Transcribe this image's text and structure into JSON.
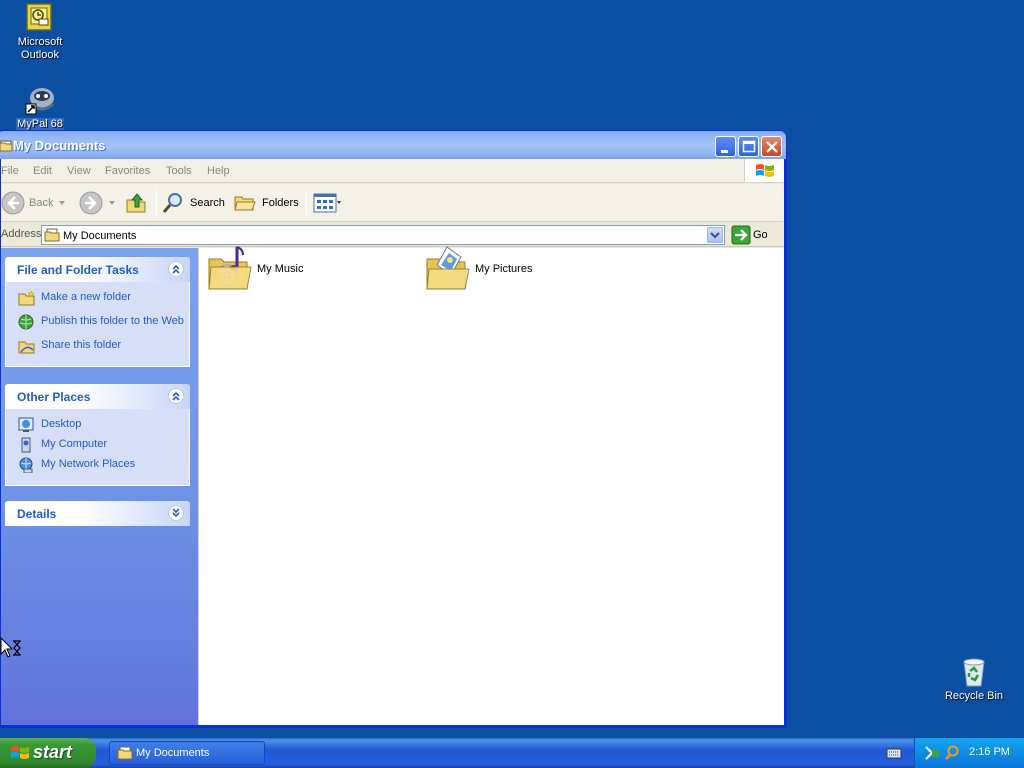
{
  "desktop": {
    "icons": [
      {
        "label": "Microsoft Outlook",
        "icon": "outlook-icon"
      },
      {
        "label": "MyPal 68",
        "icon": "mypal-icon"
      },
      {
        "label": "Recycle Bin",
        "icon": "recycle-bin-icon"
      }
    ]
  },
  "window": {
    "title": "My Documents",
    "menu": [
      "File",
      "Edit",
      "View",
      "Favorites",
      "Tools",
      "Help"
    ],
    "toolbar": {
      "back": "Back",
      "search": "Search",
      "folders": "Folders"
    },
    "address": {
      "label": "Address",
      "value": "My Documents",
      "go": "Go"
    },
    "taskpane": {
      "file_tasks": {
        "title": "File and Folder Tasks",
        "items": [
          "Make a new folder",
          "Publish this folder to the Web",
          "Share this folder"
        ]
      },
      "other_places": {
        "title": "Other Places",
        "items": [
          "Desktop",
          "My Computer",
          "My Network Places"
        ]
      },
      "details": {
        "title": "Details"
      }
    },
    "items": [
      {
        "label": "My Music",
        "icon": "music-folder-icon"
      },
      {
        "label": "My Pictures",
        "icon": "pictures-folder-icon"
      }
    ]
  },
  "taskbar": {
    "start": "start",
    "task": "My Documents",
    "clock": "2:16 PM"
  },
  "colors": {
    "desktop": "#0b4fa2",
    "link": "#215dc6",
    "start_green": "#3c9a38"
  }
}
